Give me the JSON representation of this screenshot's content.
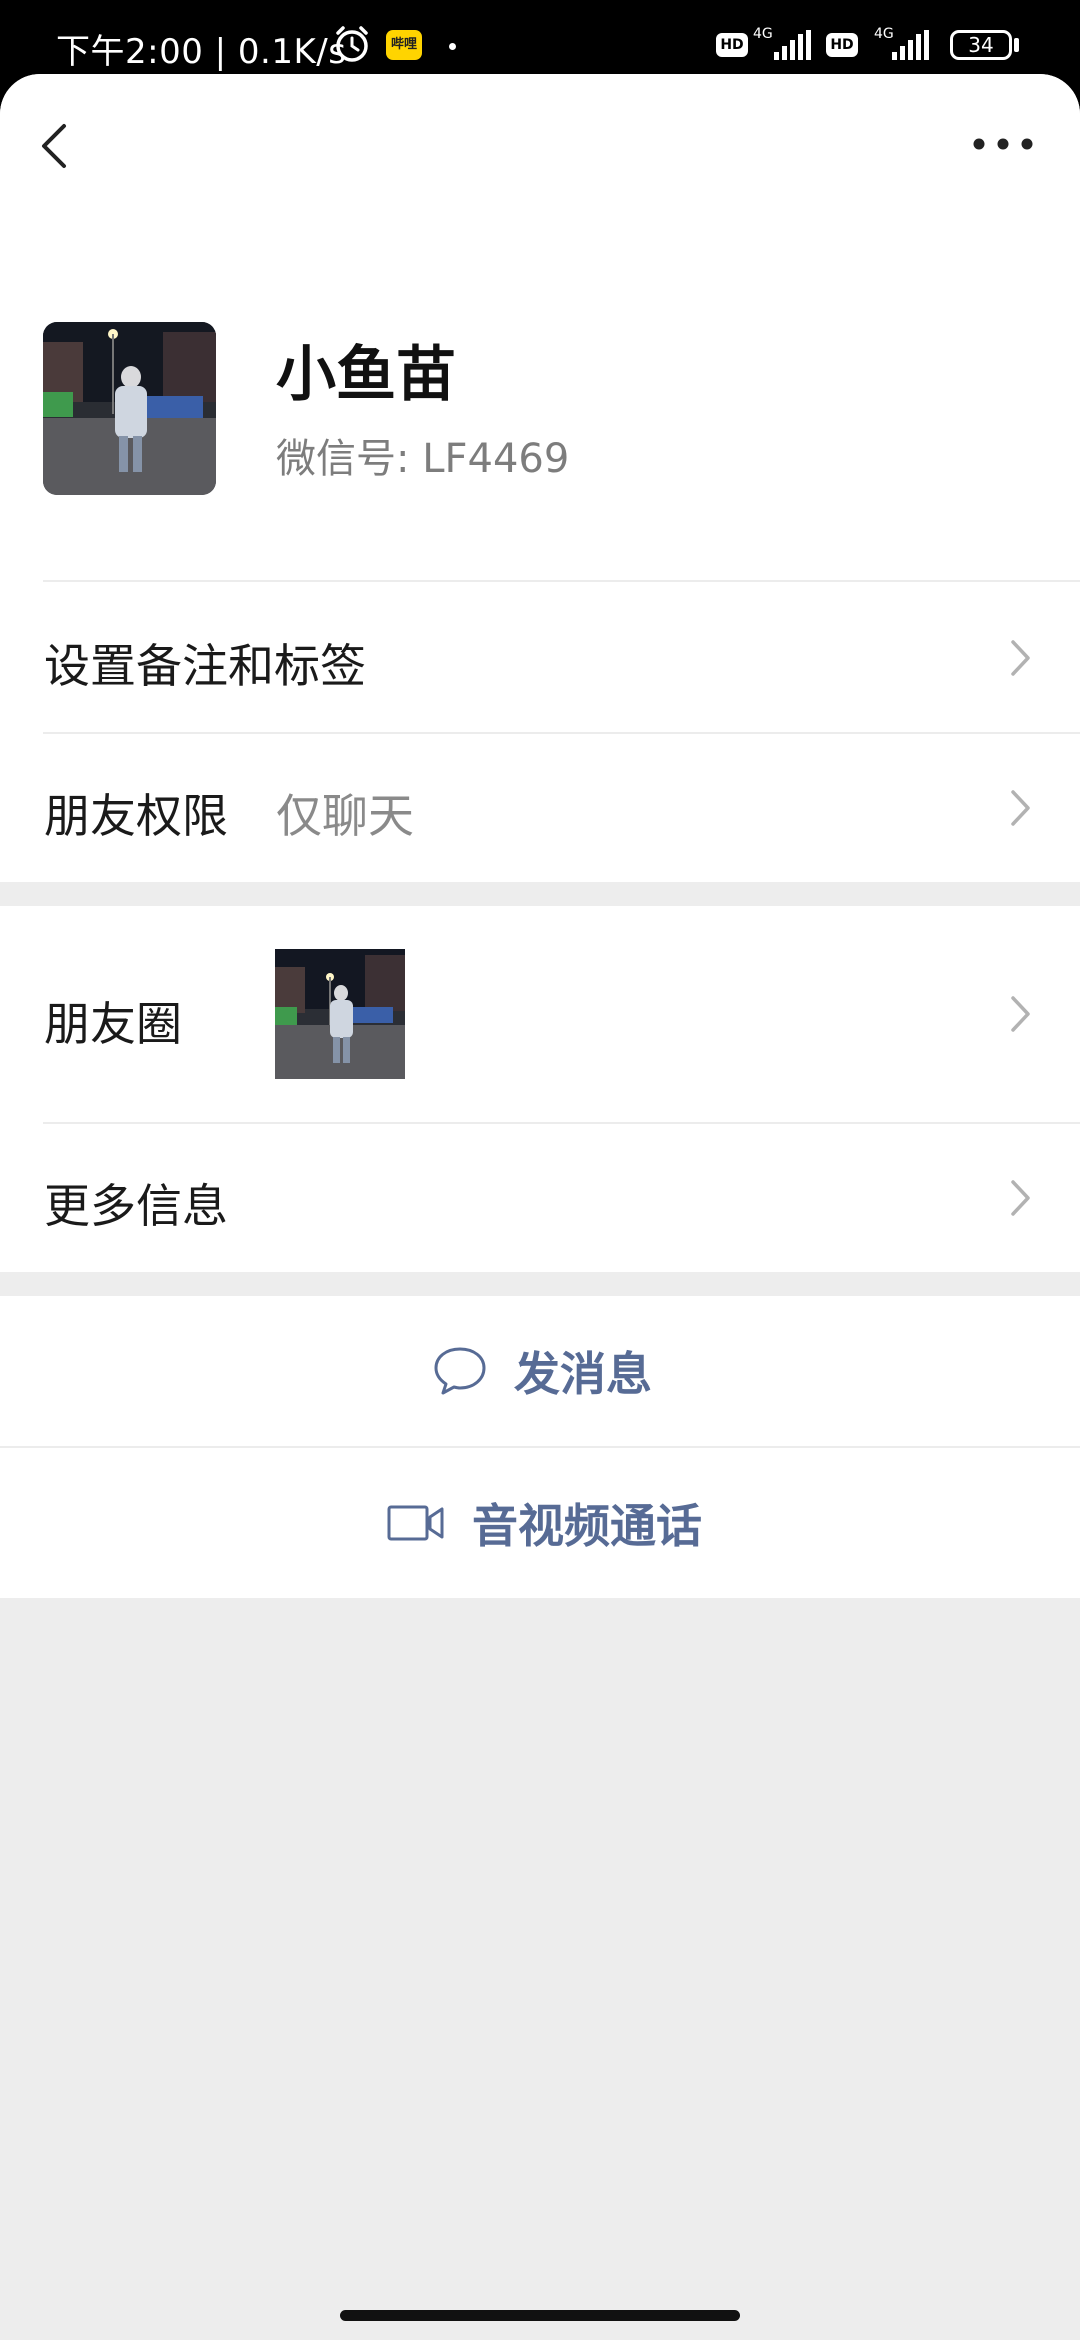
{
  "status_bar": {
    "time": "下午2:00 | 0.1K/s",
    "app_badge": "哔哩",
    "hd_1": "HD",
    "net_1": "4G",
    "hd_2": "HD",
    "net_2": "4G",
    "battery": "34"
  },
  "nav": {
    "back_icon": "chevron-left-icon",
    "more_icon": "ellipsis-icon"
  },
  "profile": {
    "name": "小鱼苗",
    "wechat_id_label": "微信号:",
    "wechat_id_value": "LF4469"
  },
  "rows": {
    "remark": {
      "label": "设置备注和标签"
    },
    "permission": {
      "label": "朋友权限",
      "value": "仅聊天"
    },
    "moments": {
      "label": "朋友圈"
    },
    "more_info": {
      "label": "更多信息"
    }
  },
  "actions": {
    "message": {
      "label": "发消息",
      "icon": "chat-bubble-icon"
    },
    "call": {
      "label": "音视频通话",
      "icon": "video-camera-icon"
    }
  },
  "colors": {
    "action_text": "#576b95",
    "background": "#ededed"
  }
}
